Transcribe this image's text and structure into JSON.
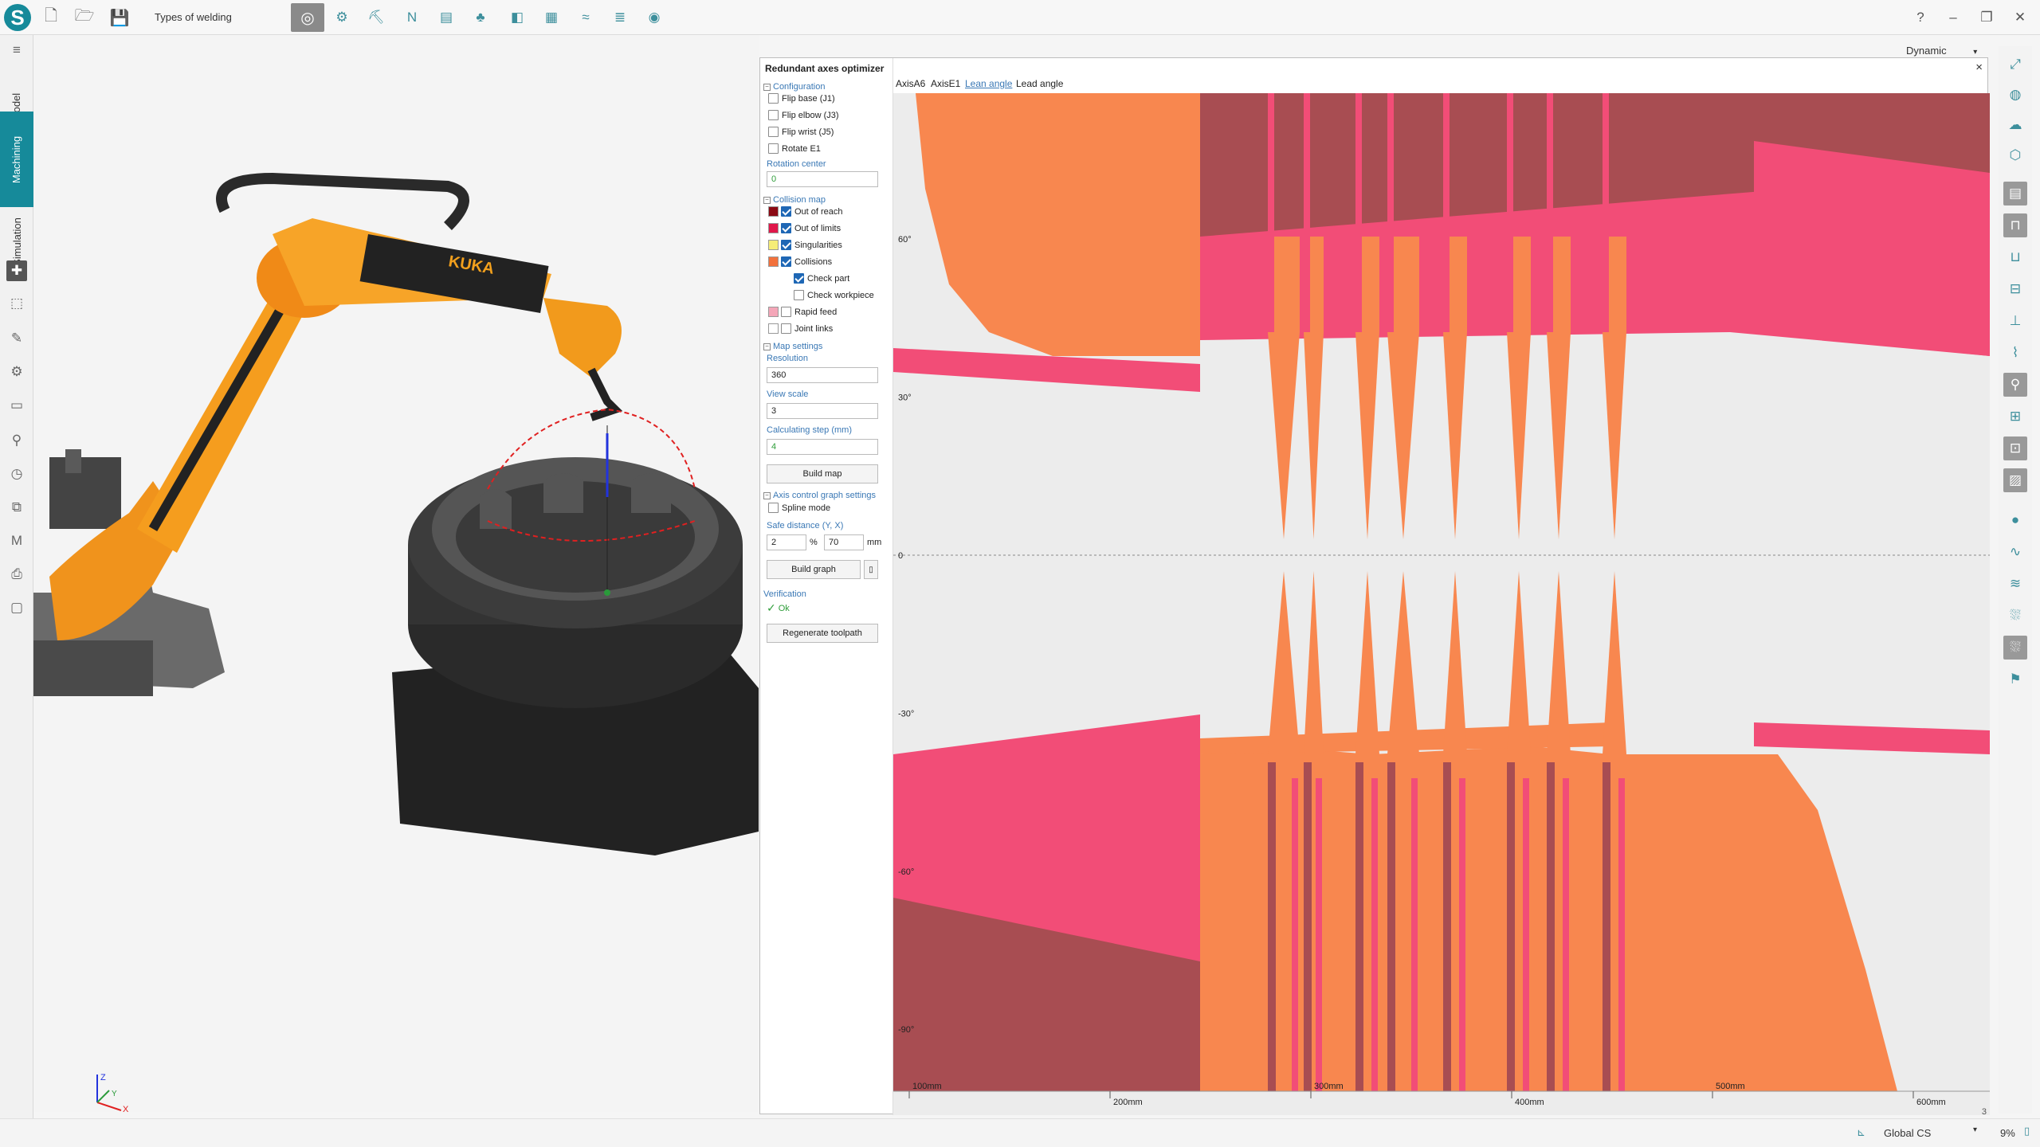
{
  "app": {
    "title": "Types of welding",
    "logo": "S",
    "accent": "#168a9a"
  },
  "toolbar": {
    "file_icons": [
      "new-file-icon",
      "open-folder-icon",
      "save-icon"
    ],
    "tool_icons": [
      "weld-tool-icon",
      "rotary-icon",
      "drill-icon",
      "nc-icon",
      "document-icon",
      "robot-icon",
      "pallet-icon",
      "panel-icon",
      "graph-icon",
      "stack-icon",
      "sphere-icon"
    ],
    "help": "?",
    "minimize": "–",
    "restore": "❐",
    "close": "✕"
  },
  "sidebar": {
    "tabs": [
      {
        "label": "Model",
        "active": false
      },
      {
        "label": "Machining",
        "active": true
      },
      {
        "label": "Simulation",
        "active": false
      }
    ]
  },
  "viewport": {
    "robot_brand": "KUKA",
    "axes": {
      "z": "Z",
      "y": "Y",
      "x": "X"
    }
  },
  "mode": {
    "value": "Dynamic"
  },
  "panel": {
    "title": "Redundant axes optimizer",
    "close": "×",
    "configuration": {
      "header": "Configuration",
      "items": [
        {
          "label": "Flip base (J1)",
          "checked": false
        },
        {
          "label": "Flip elbow (J3)",
          "checked": false
        },
        {
          "label": "Flip wrist (J5)",
          "checked": false
        },
        {
          "label": "Rotate E1",
          "checked": false
        }
      ],
      "rotation_center_label": "Rotation center",
      "rotation_center_value": "0"
    },
    "collision_map": {
      "header": "Collision map",
      "items": [
        {
          "label": "Out of reach",
          "checked": true,
          "color": "#8b0a14"
        },
        {
          "label": "Out of limits",
          "checked": true,
          "color": "#e0174a"
        },
        {
          "label": "Singularities",
          "checked": true,
          "color": "#f6ed77"
        },
        {
          "label": "Collisions",
          "checked": true,
          "color": "#f2713c"
        },
        {
          "label": "Check part",
          "checked": true,
          "indent": true
        },
        {
          "label": "Check workpiece",
          "checked": false,
          "indent": true
        },
        {
          "label": "Rapid feed",
          "checked": false,
          "color": "#f4a6b8"
        },
        {
          "label": "Joint links",
          "checked": false,
          "color": "#ffffff"
        }
      ]
    },
    "map_settings": {
      "header": "Map settings",
      "resolution_label": "Resolution",
      "resolution": "360",
      "view_scale_label": "View scale",
      "view_scale": "3",
      "calc_step_label": "Calculating step (mm)",
      "calc_step": "4",
      "build_map": "Build map"
    },
    "axis_control": {
      "header": "Axis control graph settings",
      "spline_mode": "Spline mode",
      "spline_checked": false,
      "safe_distance_label": "Safe distance (Y, X)",
      "safe_y": "2",
      "safe_y_unit": "%",
      "safe_x": "70",
      "safe_x_unit": "mm",
      "build_graph": "Build graph"
    },
    "verification": {
      "label": "Verification",
      "status": "Ok",
      "regenerate": "Regenerate toolpath"
    },
    "chart_tabs": [
      {
        "label": "AxisA6",
        "active": false
      },
      {
        "label": "AxisE1",
        "active": false
      },
      {
        "label": "Lean angle",
        "active": true
      },
      {
        "label": "Lead angle",
        "active": false
      }
    ]
  },
  "chart_data": {
    "type": "heatmap",
    "x_ticks": [
      "100mm",
      "200mm",
      "300mm",
      "400mm",
      "500mm",
      "600mm"
    ],
    "y_ticks": [
      "60°",
      "30°",
      "0",
      "-30°",
      "-60°",
      "-90°"
    ],
    "ylim": [
      -90,
      90
    ],
    "colors": {
      "out_of_reach": "#a84d52",
      "out_of_limits": "#f24d77",
      "collisions": "#f8874f"
    },
    "corner_label": "3"
  },
  "statusbar": {
    "cs": "Global CS",
    "zoom": "9%"
  }
}
